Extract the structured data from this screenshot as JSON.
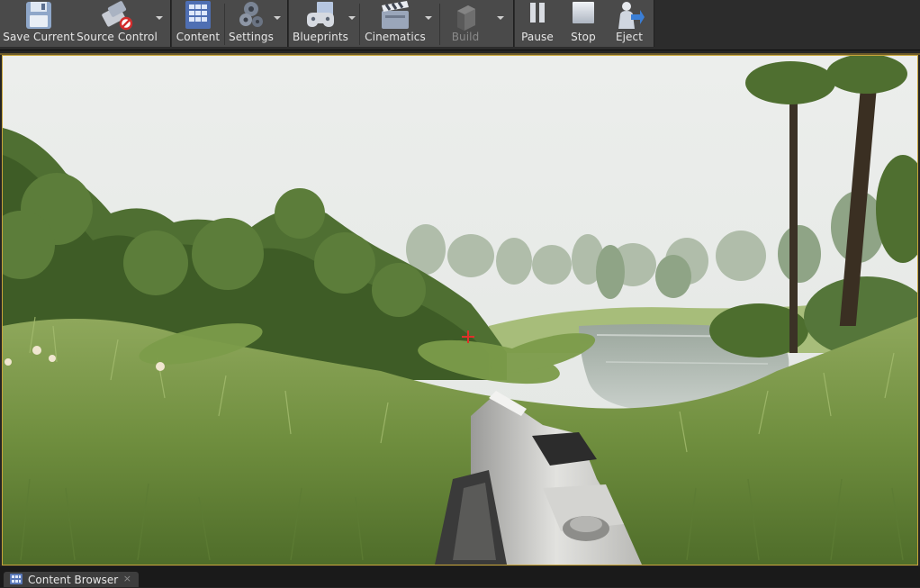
{
  "toolbar": {
    "save_current": "Save Current",
    "source_control": "Source Control",
    "content": "Content",
    "settings": "Settings",
    "blueprints": "Blueprints",
    "cinematics": "Cinematics",
    "build": "Build",
    "pause": "Pause",
    "stop": "Stop",
    "eject": "Eject"
  },
  "bottom": {
    "content_browser_tab": "Content Browser",
    "close_glyph": "×"
  },
  "icons": {
    "save": "save-icon",
    "source_control": "source-control-icon",
    "content": "content-browser-icon",
    "settings": "settings-icon",
    "blueprints": "blueprints-icon",
    "cinematics": "cinematics-icon",
    "build": "build-icon",
    "pause": "pause-icon",
    "stop": "stop-icon",
    "eject": "eject-icon",
    "crosshair": "crosshair-icon"
  },
  "colors": {
    "viewport_border": "#c9a53a",
    "crosshair": "#e0302a",
    "toolbar_bg": "#4a4a4a"
  }
}
